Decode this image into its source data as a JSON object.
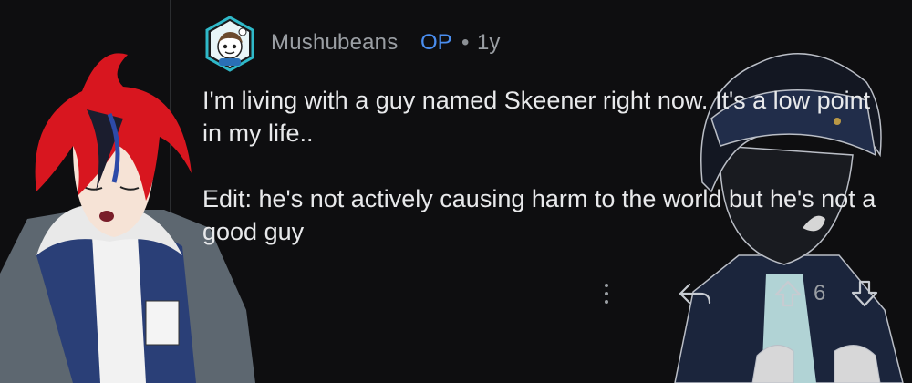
{
  "comment": {
    "username": "Mushubeans",
    "op_badge": "OP",
    "separator": "•",
    "age": "1y",
    "body_paragraph_1": "I'm living with a guy named Skeener right now. It's a low point in my life..",
    "body_paragraph_2": "Edit: he's not actively causing harm to the world but he's not a good guy",
    "vote_count": "6"
  },
  "icons": {
    "avatar": "reddit-snoo-avatar",
    "more": "vertical-ellipsis-icon",
    "reply": "reply-arrow-icon",
    "upvote": "upvote-arrow-icon",
    "downvote": "downvote-arrow-icon"
  },
  "colors": {
    "background": "#0e0e10",
    "text": "#e8e9eb",
    "meta": "#9a9ea3",
    "op": "#4a8ef0",
    "avatar_frame": "#2fb9c9"
  }
}
